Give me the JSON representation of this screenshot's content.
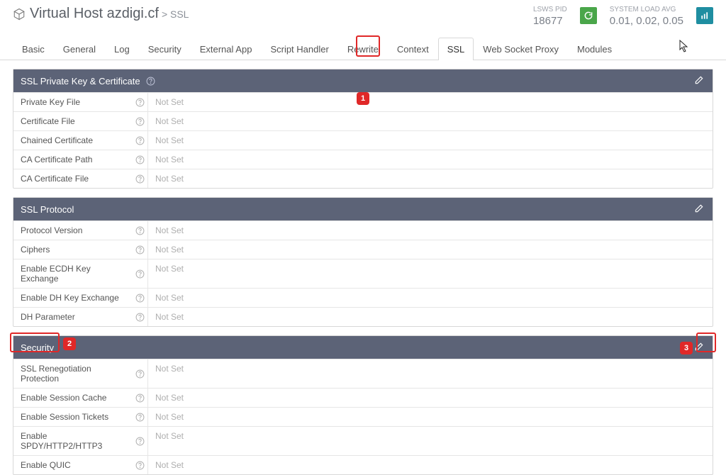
{
  "header": {
    "title": "Virtual Host azdigi.cf",
    "crumb": "> SSL",
    "lsws_label": "LSWS PID",
    "lsws_pid": "18677",
    "load_label": "SYSTEM LOAD AVG",
    "load_value": "0.01, 0.02, 0.05"
  },
  "tabs": [
    "Basic",
    "General",
    "Log",
    "Security",
    "External App",
    "Script Handler",
    "Rewrite",
    "Context",
    "SSL",
    "Web Socket Proxy",
    "Modules"
  ],
  "active_tab": 8,
  "not_set": "Not Set",
  "panel1": {
    "title": "SSL Private Key & Certificate",
    "rows": [
      "Private Key File",
      "Certificate File",
      "Chained Certificate",
      "CA Certificate Path",
      "CA Certificate File"
    ]
  },
  "panel2": {
    "title": "SSL Protocol",
    "rows": [
      "Protocol Version",
      "Ciphers",
      "Enable ECDH Key Exchange",
      "Enable DH Key Exchange",
      "DH Parameter"
    ]
  },
  "panel3": {
    "title": "Security",
    "rows": [
      "SSL Renegotiation Protection",
      "Enable Session Cache",
      "Enable Session Tickets",
      "Enable SPDY/HTTP2/HTTP3",
      "Enable QUIC"
    ]
  },
  "annot": {
    "b1": "1",
    "b2": "2",
    "b3": "3"
  }
}
